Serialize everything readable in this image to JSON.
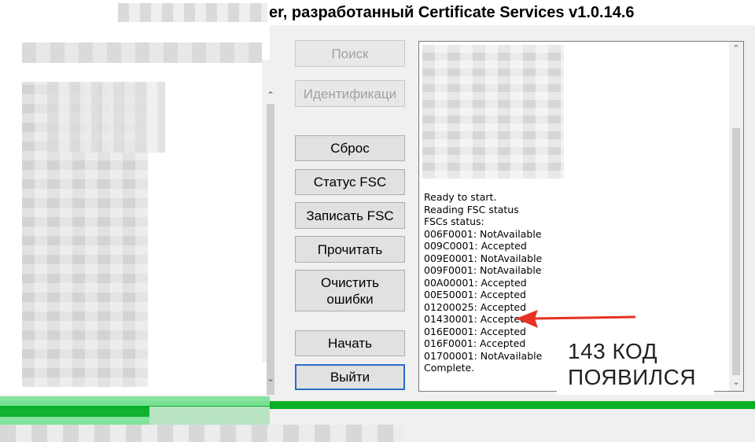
{
  "window": {
    "title": "er, разработанный Certificate Services v1.0.14.6"
  },
  "buttons": {
    "search": "Поиск",
    "identify": "Идентификаци",
    "reset": "Сброс",
    "status_fsc": "Статус FSC",
    "write_fsc": "Записать FSC",
    "read": "Прочитать",
    "clear_errors_1": "Очистить",
    "clear_errors_2": "ошибки",
    "start": "Начать",
    "exit": "Выйти"
  },
  "log": {
    "lines": [
      "Ready to start.",
      "Reading FSC status",
      "FSCs status:",
      "006F0001: NotAvailable",
      "009C0001: Accepted",
      "009E0001: NotAvailable",
      "009F0001: NotAvailable",
      "00A00001: Accepted",
      "00E50001: Accepted",
      "01200025: Accepted",
      "01430001: Accepted",
      "016E0001: Accepted",
      "016F0001: Accepted",
      "01700001: NotAvailable",
      "Complete."
    ]
  },
  "annotation": {
    "line1": "143 КОД",
    "line2": "ПОЯВИЛСЯ",
    "arrow_color": "#e53224"
  },
  "progress": {
    "value_percent": 100,
    "color": "#06b025"
  },
  "icons": {
    "scroll_up": "chevron-up-icon",
    "scroll_down": "chevron-down-icon"
  }
}
